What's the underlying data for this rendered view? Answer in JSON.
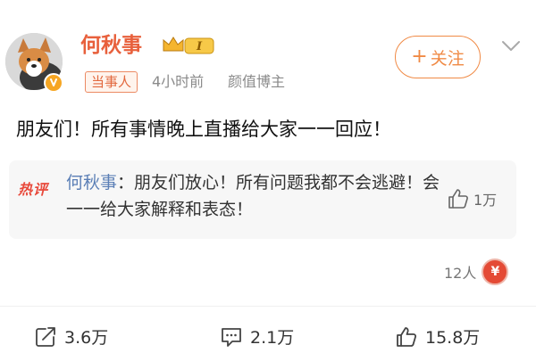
{
  "post": {
    "author": {
      "name": "何秋事",
      "tag": "当事人",
      "time": "4小时前",
      "role": "颜值博主",
      "rank_badge_text": "I"
    },
    "follow_button": {
      "icon": "plus-icon",
      "label": "关注"
    },
    "content": "朋友们！所有事情晚上直播给大家一一回应！",
    "hot_comment": {
      "label": "热评",
      "user": "何秋事",
      "separator": "：",
      "text": "朋友们放心！所有问题我都不会逃避！会一一给大家解释和表态！",
      "likes": "1万"
    },
    "reward": {
      "count": "12人",
      "coin_symbol": "¥"
    },
    "actions": {
      "share": "3.6万",
      "comment": "2.1万",
      "like": "15.8万"
    }
  },
  "colors": {
    "username": "#e8603c",
    "follow": "#f08a45",
    "hot_label": "#e8493b",
    "hot_user": "#5b7fb6",
    "coin": "#e44a35"
  }
}
